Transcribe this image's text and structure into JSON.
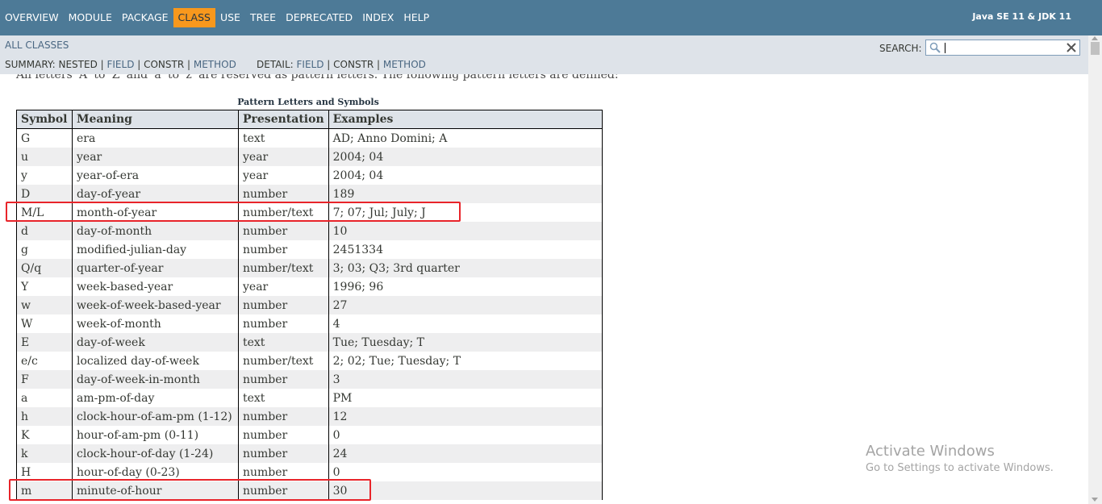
{
  "topnav": {
    "items": [
      "OVERVIEW",
      "MODULE",
      "PACKAGE",
      "CLASS",
      "USE",
      "TREE",
      "DEPRECATED",
      "INDEX",
      "HELP"
    ],
    "active_index": 3,
    "about": "Java SE 11 & JDK 11"
  },
  "subnav": {
    "all_classes": "ALL CLASSES",
    "summary_label": "SUMMARY: NESTED | ",
    "summary_field": "FIELD",
    "sep1": " | ",
    "summary_constr": "CONSTR",
    "sep2": " | ",
    "summary_method": "METHOD",
    "detail_label": "DETAIL: ",
    "detail_field": "FIELD",
    "sep3": " | CONSTR | ",
    "detail_method": "METHOD",
    "search_label": "SEARCH:",
    "search_value": ""
  },
  "content": {
    "intro": "All letters 'A' to 'Z' and 'a' to 'z' are reserved as pattern letters. The following pattern letters are defined:",
    "caption": "Pattern Letters and Symbols",
    "headers": [
      "Symbol",
      "Meaning",
      "Presentation",
      "Examples"
    ],
    "rows": [
      [
        "G",
        "era",
        "text",
        "AD; Anno Domini; A"
      ],
      [
        "u",
        "year",
        "year",
        "2004; 04"
      ],
      [
        "y",
        "year-of-era",
        "year",
        "2004; 04"
      ],
      [
        "D",
        "day-of-year",
        "number",
        "189"
      ],
      [
        "M/L",
        "month-of-year",
        "number/text",
        "7; 07; Jul; July; J"
      ],
      [
        "d",
        "day-of-month",
        "number",
        "10"
      ],
      [
        "g",
        "modified-julian-day",
        "number",
        "2451334"
      ],
      [
        "Q/q",
        "quarter-of-year",
        "number/text",
        "3; 03; Q3; 3rd quarter"
      ],
      [
        "Y",
        "week-based-year",
        "year",
        "1996; 96"
      ],
      [
        "w",
        "week-of-week-based-year",
        "number",
        "27"
      ],
      [
        "W",
        "week-of-month",
        "number",
        "4"
      ],
      [
        "E",
        "day-of-week",
        "text",
        "Tue; Tuesday; T"
      ],
      [
        "e/c",
        "localized day-of-week",
        "number/text",
        "2; 02; Tue; Tuesday; T"
      ],
      [
        "F",
        "day-of-week-in-month",
        "number",
        "3"
      ],
      [
        "a",
        "am-pm-of-day",
        "text",
        "PM"
      ],
      [
        "h",
        "clock-hour-of-am-pm (1-12)",
        "number",
        "12"
      ],
      [
        "K",
        "hour-of-am-pm (0-11)",
        "number",
        "0"
      ],
      [
        "k",
        "clock-hour-of-day (1-24)",
        "number",
        "24"
      ],
      [
        "H",
        "hour-of-day (0-23)",
        "number",
        "0"
      ],
      [
        "m",
        "minute-of-hour",
        "number",
        "30"
      ]
    ]
  },
  "watermark": {
    "title": "Activate Windows",
    "subtitle": "Go to Settings to activate Windows."
  },
  "colors": {
    "nav_bg": "#4d7a97",
    "nav_active": "#f8981d",
    "subnav_bg": "#dee3e9",
    "highlight": "#e8242a"
  }
}
